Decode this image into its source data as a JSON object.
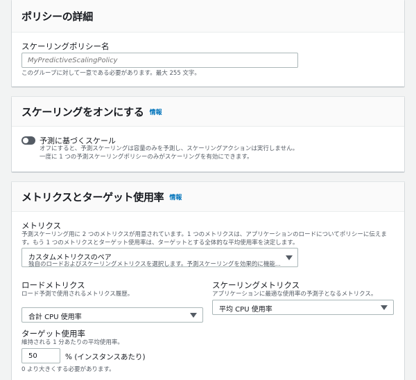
{
  "policy_details": {
    "title": "ポリシーの詳細",
    "name_label": "スケーリングポリシー名",
    "name_placeholder": "MyPredictiveScalingPolicy",
    "name_hint": "このグループに対して一意である必要があります。最大 255 文字。"
  },
  "scaling_toggle": {
    "title": "スケーリングをオンにする",
    "info": "情報",
    "toggle_label": "予測に基づくスケール",
    "toggle_state": "off",
    "desc_line1": "オフにすると、予測スケーリングは容量のみを予測し、スケーリングアクションは実行しません。",
    "desc_line2": "一度に 1 つの予測スケーリングポリシーのみがスケーリングを有効にできます。"
  },
  "metrics": {
    "title": "メトリクスとターゲット使用率",
    "info": "情報",
    "metrics_label": "メトリクス",
    "metrics_desc_line1": "予測スケーリング用に 2 つのメトリクスが用意されています。1 つのメトリクスは、アプリケーションのロードについてポリシーに伝えま",
    "metrics_desc_line2": "す。もう 1 つのメトリクスとターゲット使用率は、ターゲットとする全体的な平均使用率を決定します。",
    "metric_pair_value": "カスタムメトリクスのペア",
    "metric_pair_sub": "独自のロードおよびスケーリングメトリクスを選択します。予測スケーリングを効果的に機能...",
    "load_metric_label": "ロードメトリクス",
    "load_metric_desc": "ロード予測で使用されるメトリクス履歴。",
    "load_metric_value": "合計 CPU 使用率",
    "scaling_metric_label": "スケーリングメトリクス",
    "scaling_metric_desc": "アプリケーションに最適な使用率の予測子となるメトリクス。",
    "scaling_metric_value": "平均 CPU 使用率",
    "target_label": "ターゲット使用率",
    "target_desc": "維持される 1 分あたりの平均使用率。",
    "target_value": "50",
    "target_unit": "% (インスタンスあたり)",
    "target_hint": "0 より大きくする必要があります。"
  },
  "colors": {
    "background": "#f2f3f3",
    "link": "#0073bb",
    "toggle_off": "#545b64"
  }
}
